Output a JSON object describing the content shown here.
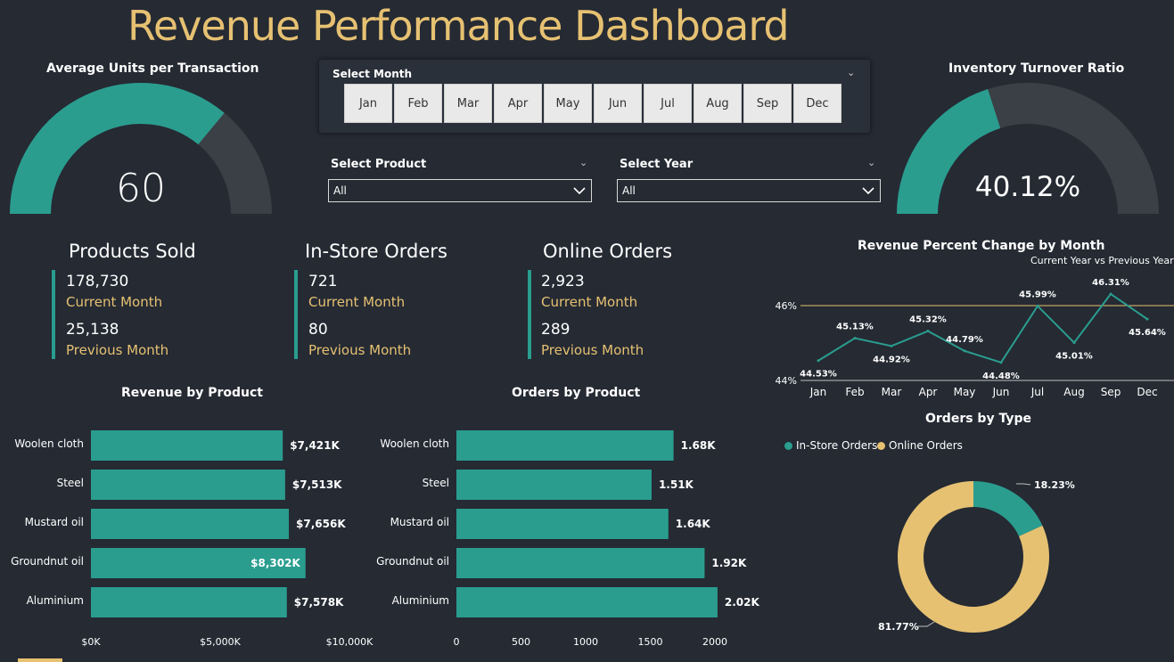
{
  "header": {
    "title": "Revenue Performance Dashboard"
  },
  "gauge_left": {
    "title": "Average Units per Transaction",
    "value": "60",
    "fill_fraction": 0.72
  },
  "gauge_right": {
    "title": "Inventory Turnover Ratio",
    "value": "40.12%",
    "fill_fraction": 0.4012
  },
  "month_slicer": {
    "label": "Select Month",
    "months": [
      "Jan",
      "Feb",
      "Mar",
      "Apr",
      "May",
      "Jun",
      "Jul",
      "Aug",
      "Sep",
      "Dec"
    ]
  },
  "product_filter": {
    "label": "Select Product",
    "value": "All"
  },
  "year_filter": {
    "label": "Select Year",
    "value": "All"
  },
  "kpis": [
    {
      "title": "Products Sold",
      "current_value": "178,730",
      "current_label": "Current Month",
      "previous_value": "25,138",
      "previous_label": "Previous Month"
    },
    {
      "title": "In-Store Orders",
      "current_value": "721",
      "current_label": "Current Month",
      "previous_value": "80",
      "previous_label": "Previous Month"
    },
    {
      "title": "Online Orders",
      "current_value": "2,923",
      "current_label": "Current Month",
      "previous_value": "289",
      "previous_label": "Previous Month"
    }
  ],
  "colors": {
    "teal": "#2a9d8f",
    "gold": "#e6c172",
    "gauge_track": "#3b3f46",
    "background": "#252a33"
  },
  "chart_data": [
    {
      "id": "revenue_by_product",
      "type": "bar",
      "orientation": "horizontal",
      "title": "Revenue by Product",
      "categories": [
        "Woolen cloth",
        "Steel",
        "Mustard oil",
        "Groundnut oil",
        "Aluminium"
      ],
      "values": [
        7421,
        7513,
        7656,
        8302,
        7578
      ],
      "data_labels": [
        "$7,421K",
        "$7,513K",
        "$7,656K",
        "$8,302K",
        "$7,578K"
      ],
      "xlim": [
        0,
        10000
      ],
      "xticks": [
        "$0K",
        "$5,000K",
        "$10,000K"
      ]
    },
    {
      "id": "orders_by_product",
      "type": "bar",
      "orientation": "horizontal",
      "title": "Orders by Product",
      "categories": [
        "Woolen cloth",
        "Steel",
        "Mustard oil",
        "Groundnut oil",
        "Aluminium"
      ],
      "values": [
        1680,
        1510,
        1640,
        1920,
        2020
      ],
      "data_labels": [
        "1.68K",
        "1.51K",
        "1.64K",
        "1.92K",
        "2.02K"
      ],
      "xlim": [
        0,
        2000
      ],
      "xticks": [
        "0",
        "500",
        "1000",
        "1500",
        "2000"
      ]
    },
    {
      "id": "revenue_percent_change",
      "type": "line",
      "title": "Revenue Percent Change by Month",
      "subtitle": "Current Year vs Previous Year",
      "categories": [
        "Jan",
        "Feb",
        "Mar",
        "Apr",
        "May",
        "Jun",
        "Jul",
        "Aug",
        "Sep",
        "Dec"
      ],
      "values": [
        44.53,
        45.13,
        44.92,
        45.32,
        44.79,
        44.48,
        45.99,
        45.01,
        46.31,
        45.64
      ],
      "data_labels": [
        "44.53%",
        "45.13%",
        "44.92%",
        "45.32%",
        "44.79%",
        "44.48%",
        "45.99%",
        "45.01%",
        "46.31%",
        "45.64%"
      ],
      "ylim": [
        44,
        46
      ],
      "yticks": [
        "44%",
        "46%"
      ]
    },
    {
      "id": "orders_by_type",
      "type": "pie",
      "title": "Orders by Type",
      "series": [
        {
          "name": "In-Store Orders",
          "value": 18.23,
          "label": "18.23%"
        },
        {
          "name": "Online Orders",
          "value": 81.77,
          "label": "81.77%"
        }
      ],
      "legend": "top-left"
    }
  ]
}
